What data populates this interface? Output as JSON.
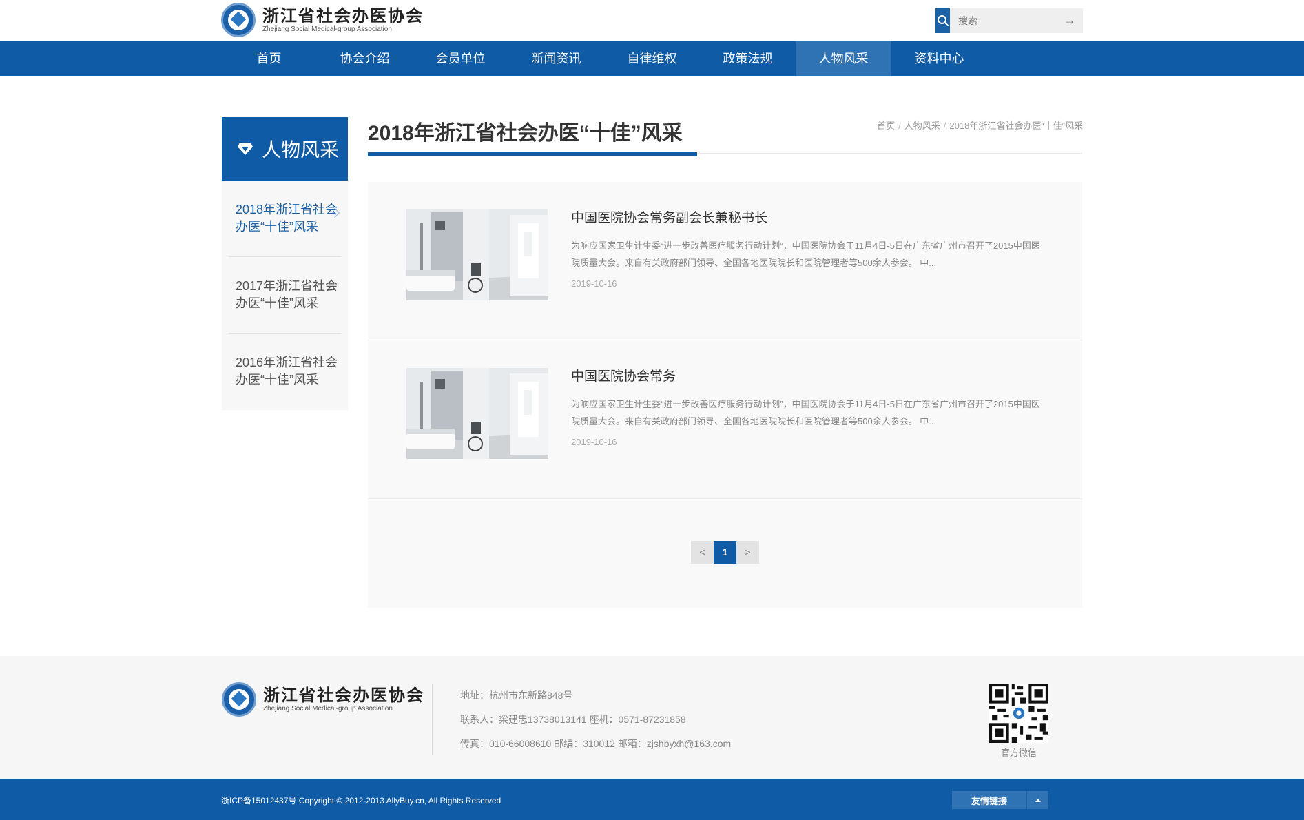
{
  "header": {
    "logo_cn": "浙江省社会办医协会",
    "logo_en": "Zhejiang Social Medical-group Association",
    "search_placeholder": "搜索",
    "search_go": "→"
  },
  "nav": {
    "items": [
      {
        "label": "首页"
      },
      {
        "label": "协会介绍"
      },
      {
        "label": "会员单位"
      },
      {
        "label": "新闻资讯"
      },
      {
        "label": "自律维权"
      },
      {
        "label": "政策法规"
      },
      {
        "label": "人物风采"
      },
      {
        "label": "资料中心"
      }
    ],
    "active_index": 6
  },
  "sidebar": {
    "title": "人物风采",
    "items": [
      {
        "label": "2018年浙江省社会办医“十佳”风采"
      },
      {
        "label": "2017年浙江省社会办医“十佳”风采"
      },
      {
        "label": "2016年浙江省社会办医“十佳”风采"
      }
    ],
    "active_index": 0
  },
  "main": {
    "title": "2018年浙江省社会办医“十佳”风采",
    "breadcrumb": [
      "首页",
      "人物风采",
      "2018年浙江省社会办医“十佳”风采"
    ],
    "breadcrumb_sep": "/",
    "articles": [
      {
        "title": "中国医院协会常务副会长兼秘书长",
        "summary": "为响应国家卫生计生委“进一步改善医疗服务行动计划”，中国医院协会于11月4日-5日在广东省广州市召开了2015中国医院质量大会。来自有关政府部门领导、全国各地医院院长和医院管理者等500余人参会。 中...",
        "date": "2019-10-16"
      },
      {
        "title": "中国医院协会常务",
        "summary": "为响应国家卫生计生委“进一步改善医疗服务行动计划”，中国医院协会于11月4日-5日在广东省广州市召开了2015中国医院质量大会。来自有关政府部门领导、全国各地医院院长和医院管理者等500余人参会。 中...",
        "date": "2019-10-16"
      }
    ],
    "pagination": {
      "prev": "<",
      "current": "1",
      "next": ">"
    }
  },
  "footer": {
    "address": "地址：杭州市东新路848号",
    "contact": "联系人：梁建忠13738013141 座机：0571-87231858",
    "fax": "传真：010-66008610 邮编：310012 邮箱：zjshbyxh@163.com",
    "qr_label": "官方微信",
    "copyright": "浙ICP备15012437号 Copyright © 2012-2013 AllyBuy.cn, All Rights Reserved",
    "links_label": "友情链接"
  },
  "colors": {
    "primary": "#0f5ba5",
    "nav_active": "#2f73b4",
    "text": "#333333",
    "muted": "#888888"
  }
}
